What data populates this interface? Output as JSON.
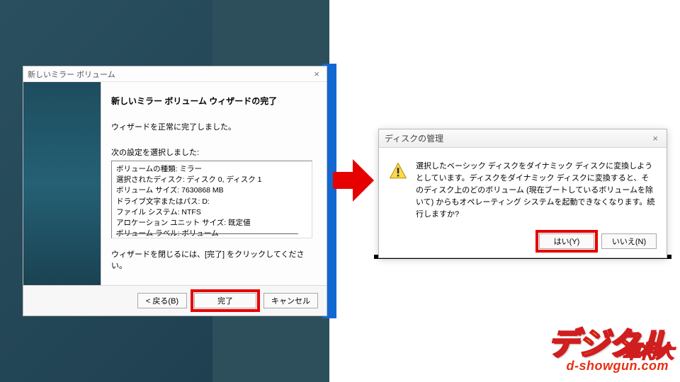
{
  "wizard": {
    "title": "新しいミラー ボリューム",
    "heading": "新しいミラー ボリューム ウィザードの完了",
    "completed_text": "ウィザードを正常に完了しました。",
    "selected_text": "次の設定を選択しました:",
    "summary": [
      "ボリュームの種類: ミラー",
      "選択されたディスク: ディスク 0, ディスク 1",
      "ボリューム サイズ: 7630868 MB",
      "ドライブ文字またはパス: D:",
      "ファイル システム: NTFS",
      "アロケーション ユニット サイズ: 既定値",
      "ボリューム ラベル: ボリューム"
    ],
    "close_hint": "ウィザードを閉じるには、[完了] をクリックしてください。",
    "back_btn": "< 戻る(B)",
    "finish_btn": "完了",
    "cancel_btn": "キャンセル"
  },
  "confirm": {
    "title": "ディスクの管理",
    "message": "選択したベーシック ディスクをダイナミック ディスクに変換しようとしています。ディスクをダイナミック ディスクに変換すると、そのディスク上のどのボリューム (現在ブートしているボリュームを除いて) からもオペレーティング システムを起動できなくなります。続行しますか?",
    "yes_btn": "はい(Y)",
    "no_btn": "いいえ(N)"
  },
  "logo": {
    "main": "デジタル",
    "side": "大将軍",
    "sub": "d-showgun.com"
  }
}
